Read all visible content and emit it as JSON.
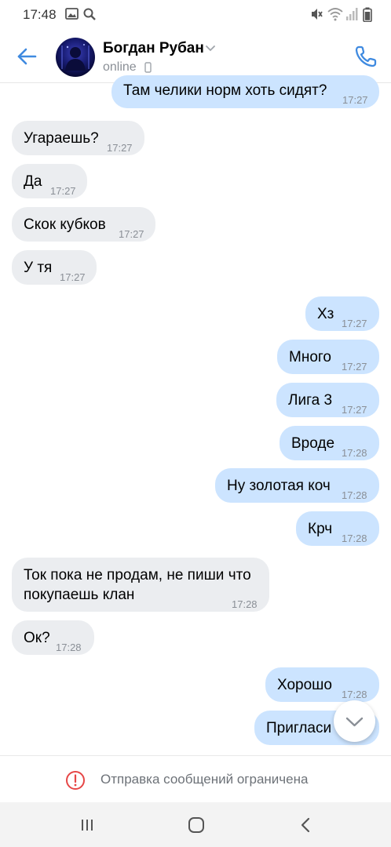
{
  "status_bar": {
    "time": "17:48",
    "left_icons": [
      "image-icon",
      "search-icon"
    ],
    "right_icons": [
      "mute-icon",
      "wifi-icon",
      "signal-icon",
      "battery-icon"
    ]
  },
  "header": {
    "contact_name": "Богдан Рубан",
    "status": "online",
    "accent_color": "#3f8ae0",
    "icons": [
      "back-arrow-icon",
      "chevron-down-icon",
      "mobile-icon",
      "phone-icon"
    ]
  },
  "messages": [
    {
      "direction": "out",
      "text": "Там челики норм хоть сидят?",
      "time": "17:27"
    },
    {
      "direction": "in",
      "text": "Угараешь?",
      "time": "17:27"
    },
    {
      "direction": "in",
      "text": "Да",
      "time": "17:27"
    },
    {
      "direction": "in",
      "text": "Скок кубков",
      "time": "17:27"
    },
    {
      "direction": "in",
      "text": "У тя",
      "time": "17:27"
    },
    {
      "direction": "out",
      "text": "Хз",
      "time": "17:27"
    },
    {
      "direction": "out",
      "text": "Много",
      "time": "17:27"
    },
    {
      "direction": "out",
      "text": "Лига 3",
      "time": "17:27"
    },
    {
      "direction": "out",
      "text": "Вроде",
      "time": "17:28"
    },
    {
      "direction": "out",
      "text": "Ну золотая коч",
      "time": "17:28"
    },
    {
      "direction": "out",
      "text": "Крч",
      "time": "17:28"
    },
    {
      "direction": "in",
      "text": "Ток пока не продам, не пиши что покупаешь клан",
      "time": "17:28"
    },
    {
      "direction": "in",
      "text": "Ок?",
      "time": "17:28"
    },
    {
      "direction": "out",
      "text": "Хорошо",
      "time": "17:28"
    },
    {
      "direction": "out",
      "text": "Пригласи",
      "time": ""
    }
  ],
  "colors": {
    "incoming_bubble": "#ebedf0",
    "outgoing_bubble": "#cce4ff",
    "timestamp": "#8a8f96",
    "warning": "#e64646"
  },
  "restriction": {
    "text": "Отправка сообщений ограничена",
    "icon": "warning-circle-icon"
  },
  "nav_bar": {
    "buttons": [
      "recent-apps-icon",
      "home-icon",
      "back-icon"
    ]
  }
}
